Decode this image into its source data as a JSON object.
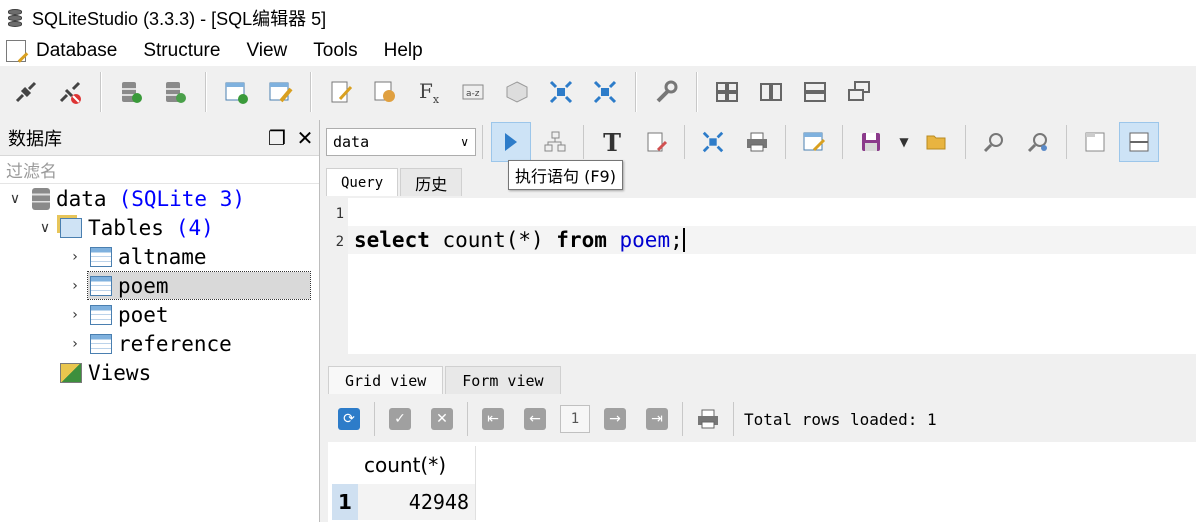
{
  "window": {
    "title": "SQLiteStudio (3.3.3) - [SQL编辑器 5]"
  },
  "menu": {
    "items": [
      "Database",
      "Structure",
      "View",
      "Tools",
      "Help"
    ]
  },
  "dock": {
    "title": "数据库",
    "filter_placeholder": "过滤名",
    "database": {
      "name": "data",
      "type": "(SQLite 3)"
    },
    "tables_group": {
      "label": "Tables",
      "count": "(4)"
    },
    "tables": [
      "altname",
      "poem",
      "poet",
      "reference"
    ],
    "selected_table": "poem",
    "views_label": "Views"
  },
  "editor": {
    "db_selector": "data",
    "tabs": [
      "Query",
      "历史"
    ],
    "active_tab": "Query",
    "tooltip": "执行语句 (F9)",
    "line_numbers": [
      "1",
      "2"
    ],
    "sql_tokens": {
      "select": "select",
      "count": " count(*) ",
      "from": "from",
      "table": " poem",
      "end": ";"
    }
  },
  "results": {
    "tabs": [
      "Grid view",
      "Form view"
    ],
    "page": "1",
    "rows_info": "Total rows loaded: 1",
    "column": "count(*)",
    "row_number": "1",
    "value": "42948"
  }
}
